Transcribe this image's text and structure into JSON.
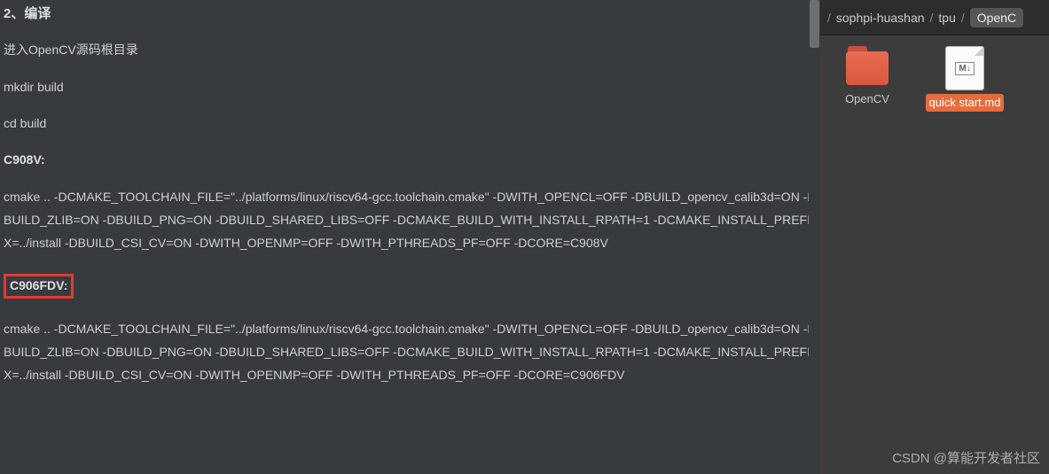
{
  "document": {
    "heading": "2、编译",
    "para1": "进入OpenCV源码根目录",
    "cmd1": "mkdir build",
    "cmd2": "cd build",
    "sub1": "C908V:",
    "code1": "cmake .. -DCMAKE_TOOLCHAIN_FILE=\"../platforms/linux/riscv64-gcc.toolchain.cmake\" -DWITH_OPENCL=OFF -DBUILD_opencv_calib3d=ON -DBUILD_ZLIB=ON -DBUILD_PNG=ON -DBUILD_SHARED_LIBS=OFF -DCMAKE_BUILD_WITH_INSTALL_RPATH=1 -DCMAKE_INSTALL_PREFIX=../install -DBUILD_CSI_CV=ON -DWITH_OPENMP=OFF -DWITH_PTHREADS_PF=OFF -DCORE=C908V",
    "sub2": "C906FDV:",
    "code2": "cmake .. -DCMAKE_TOOLCHAIN_FILE=\"../platforms/linux/riscv64-gcc.toolchain.cmake\" -DWITH_OPENCL=OFF -DBUILD_opencv_calib3d=ON -DBUILD_ZLIB=ON -DBUILD_PNG=ON -DBUILD_SHARED_LIBS=OFF -DCMAKE_BUILD_WITH_INSTALL_RPATH=1 -DCMAKE_INSTALL_PREFIX=../install -DBUILD_CSI_CV=ON -DWITH_OPENMP=OFF -DWITH_PTHREADS_PF=OFF -DCORE=C906FDV"
  },
  "breadcrumb": {
    "items": [
      "sophpi-huashan",
      "tpu",
      "OpenC"
    ]
  },
  "files": {
    "folder_name": "OpenCV",
    "file_name": "quick start.md",
    "md_symbol": "M↓"
  },
  "watermark": "CSDN @算能开发者社区"
}
